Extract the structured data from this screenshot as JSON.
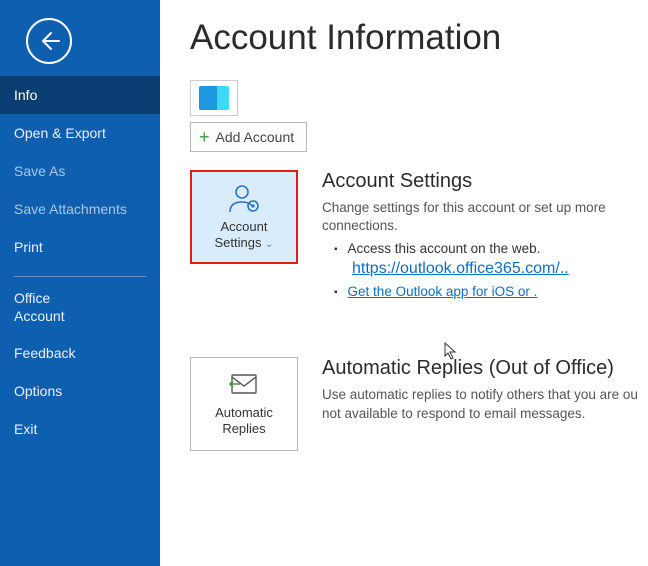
{
  "sidebar": {
    "items": [
      {
        "label": "Info",
        "selected": true
      },
      {
        "label": "Open & Export"
      },
      {
        "label": "Save As",
        "dim": true
      },
      {
        "label": "Save Attachments",
        "dim": true
      },
      {
        "label": "Print"
      }
    ],
    "secondary": [
      {
        "label": "Office\nAccount"
      },
      {
        "label": "Feedback"
      },
      {
        "label": "Options"
      },
      {
        "label": "Exit"
      }
    ]
  },
  "main": {
    "title": "Account Information",
    "add_account_label": "Add Account",
    "account_settings": {
      "button_line1": "Account",
      "button_line2": "Settings",
      "heading": "Account Settings",
      "desc": "Change settings for this account or set up more connections.",
      "bullet1_text": "Access this account on the web.",
      "bullet1_link": "https://outlook.office365.com/..",
      "bullet2_link": "Get the Outlook app for iOS or ."
    },
    "auto_replies": {
      "button_line1": "Automatic",
      "button_line2": "Replies",
      "heading": "Automatic Replies (Out of Office)",
      "desc": "Use automatic replies to notify others that you are ou not available to respond to email messages."
    }
  }
}
